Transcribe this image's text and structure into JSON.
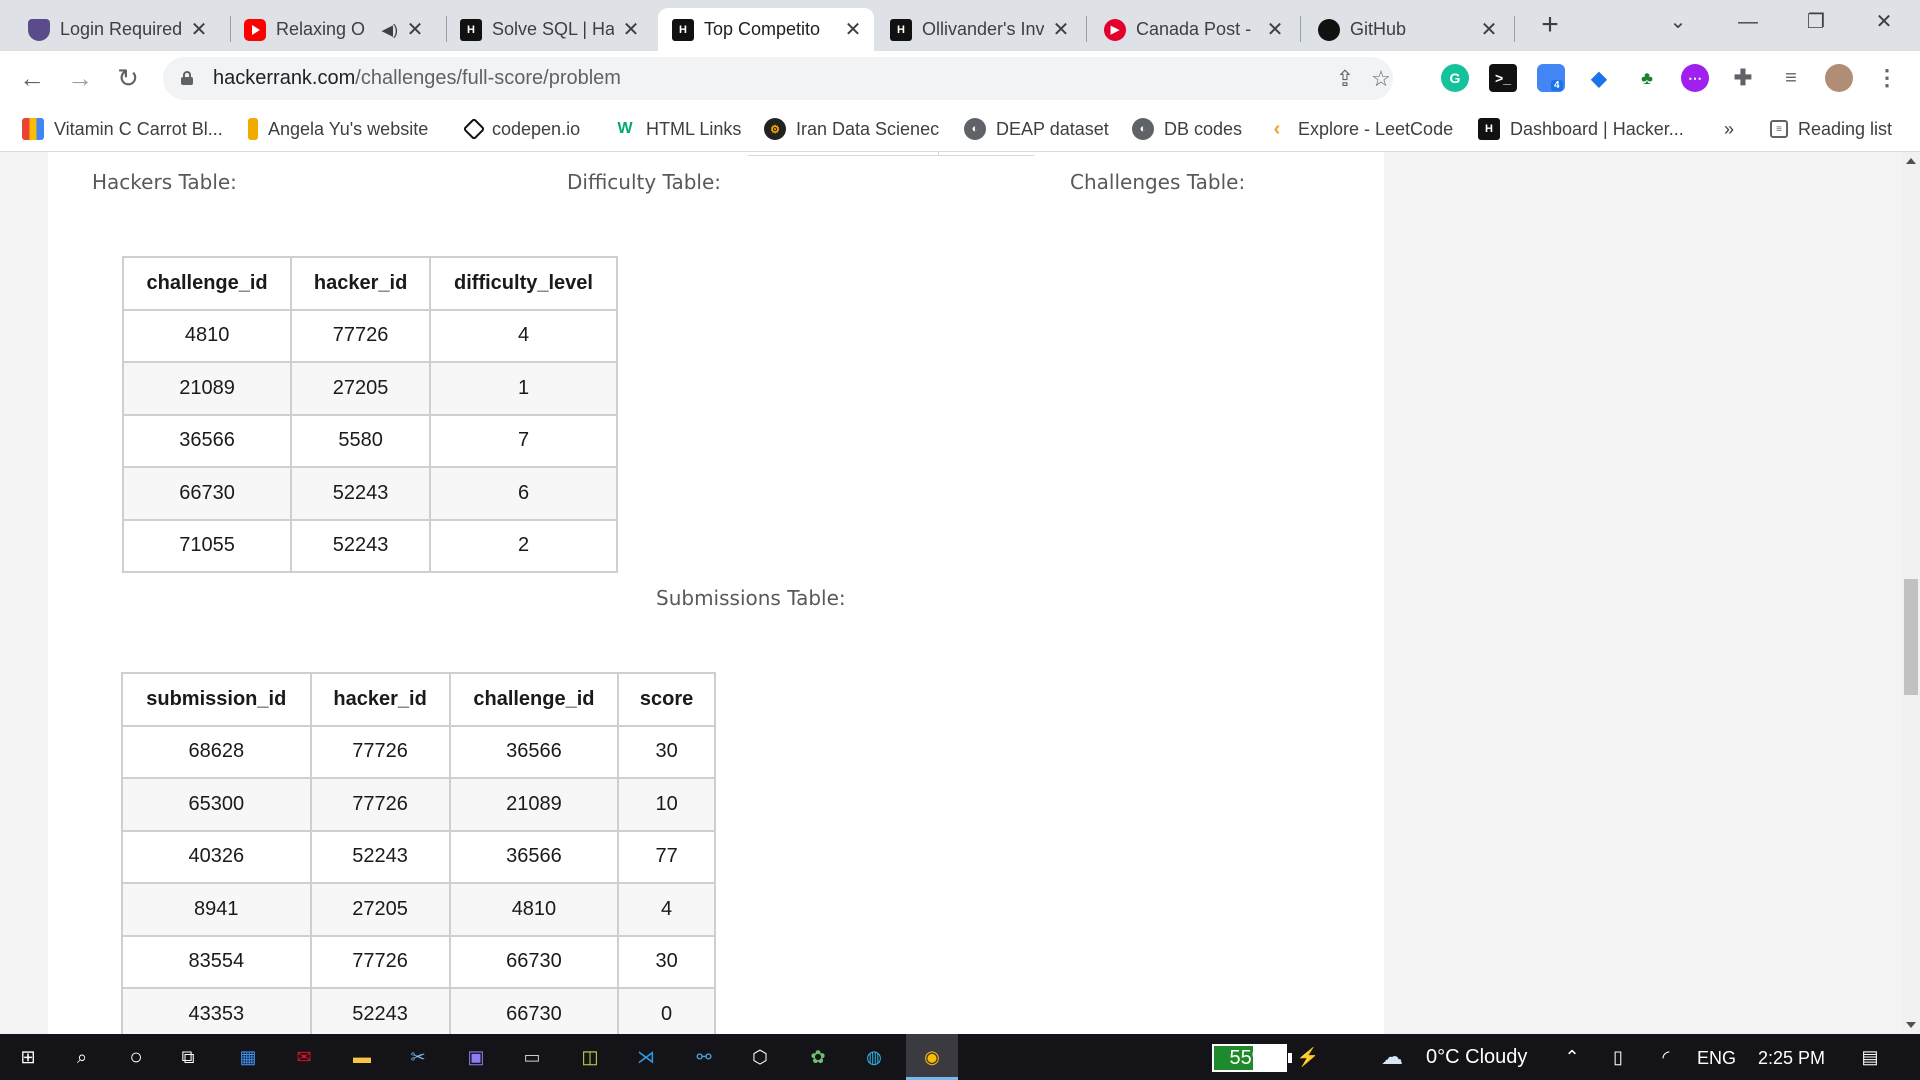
{
  "browser": {
    "tabs": [
      {
        "label": "Login Required",
        "icon": "shield-icon",
        "active": false
      },
      {
        "label": "Relaxing O",
        "icon": "youtube-icon",
        "active": false
      },
      {
        "label": "Solve SQL | Ha",
        "icon": "hackerrank-icon",
        "active": false
      },
      {
        "label": "Top Competito",
        "icon": "hackerrank-icon",
        "active": true
      },
      {
        "label": "Ollivander's Inv",
        "icon": "hackerrank-icon",
        "active": false
      },
      {
        "label": "Canada Post - ",
        "icon": "canada-post-icon",
        "active": false
      },
      {
        "label": "GitHub",
        "icon": "github-icon",
        "active": false
      }
    ],
    "new_tab": "+",
    "address": {
      "domain": "hackerrank.com",
      "path": "/challenges/full-score/problem"
    },
    "extension_badge": "4",
    "bookmarks": [
      {
        "label": "Vitamin C Carrot Bl...",
        "icon": "gift-icon"
      },
      {
        "label": "Angela Yu's website",
        "icon": "bookmark-icon"
      },
      {
        "label": "codepen.io",
        "icon": "codepen-icon"
      },
      {
        "label": "HTML Links",
        "icon": "w3-icon"
      },
      {
        "label": "Iran Data Scienec",
        "icon": "gear-logo-icon"
      },
      {
        "label": "DEAP dataset",
        "icon": "globe-icon"
      },
      {
        "label": "DB codes",
        "icon": "globe-icon"
      },
      {
        "label": "Explore - LeetCode",
        "icon": "leetcode-icon"
      },
      {
        "label": "Dashboard | Hacker...",
        "icon": "hackerrank-icon"
      }
    ],
    "bookmarks_overflow": "»",
    "reading_list": "Reading list"
  },
  "page": {
    "labels": {
      "hackers": "Hackers Table:",
      "difficulty": "Difficulty Table:",
      "challenges": "Challenges Table:",
      "submissions": "Submissions Table:"
    },
    "challenges_table": {
      "columns": [
        "challenge_id",
        "hacker_id",
        "difficulty_level"
      ],
      "rows": [
        [
          "4810",
          "77726",
          "4"
        ],
        [
          "21089",
          "27205",
          "1"
        ],
        [
          "36566",
          "5580",
          "7"
        ],
        [
          "66730",
          "52243",
          "6"
        ],
        [
          "71055",
          "52243",
          "2"
        ]
      ]
    },
    "submissions_table": {
      "columns": [
        "submission_id",
        "hacker_id",
        "challenge_id",
        "score"
      ],
      "rows": [
        [
          "68628",
          "77726",
          "36566",
          "30"
        ],
        [
          "65300",
          "77726",
          "21089",
          "10"
        ],
        [
          "40326",
          "52243",
          "36566",
          "77"
        ],
        [
          "8941",
          "27205",
          "4810",
          "4"
        ],
        [
          "83554",
          "77726",
          "66730",
          "30"
        ],
        [
          "43353",
          "52243",
          "66730",
          "0"
        ]
      ]
    }
  },
  "taskbar": {
    "battery": "55%",
    "battery_level": 0.55,
    "weather": "0°C  Cloudy",
    "language": "ENG",
    "time": "2:25 PM"
  },
  "colors": {
    "hackerrank_green": "#1ba94c",
    "active_tab_bg": "#ffffff",
    "battery_fill": "#1f8a2c"
  }
}
